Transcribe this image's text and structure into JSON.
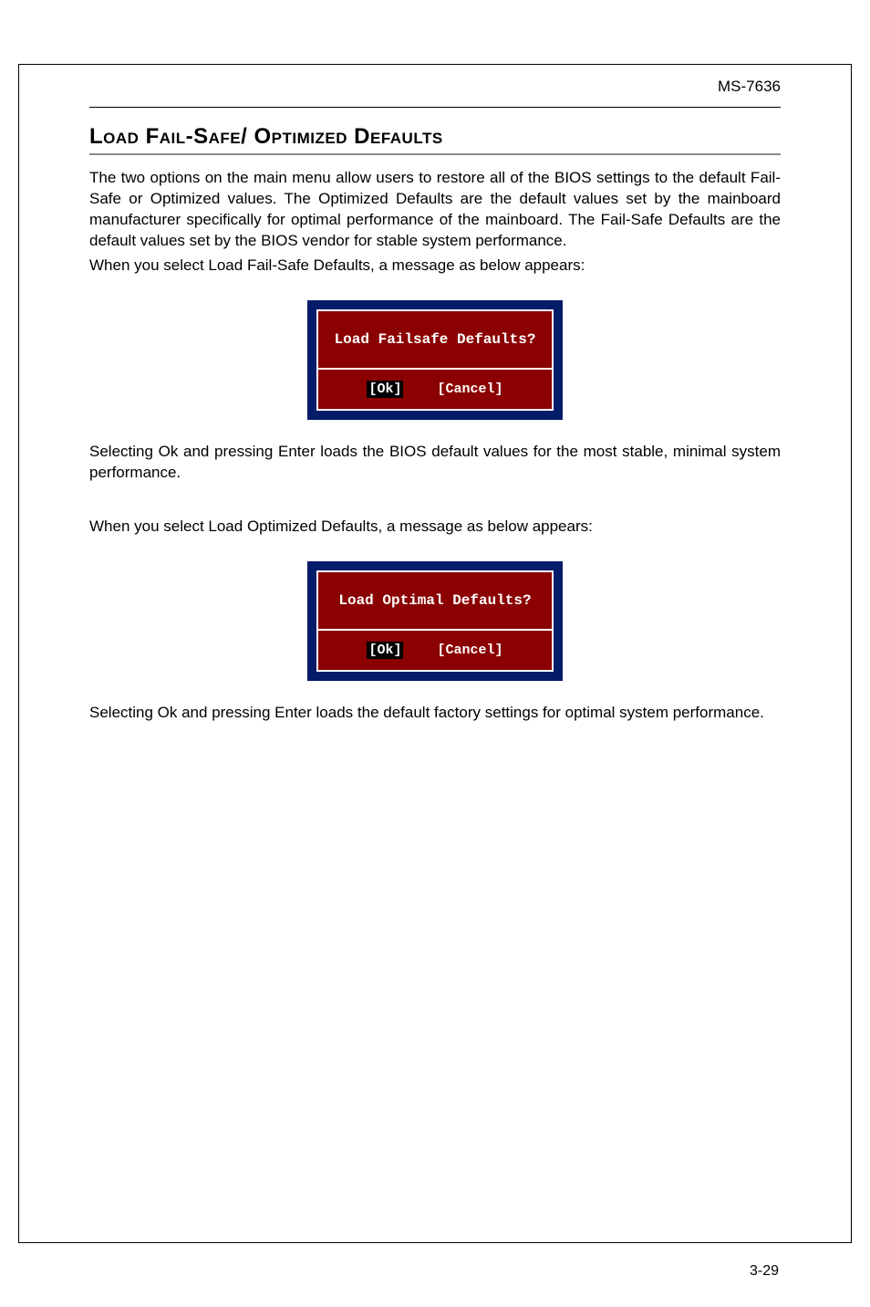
{
  "header": {
    "model": "MS-7636"
  },
  "section": {
    "title": "Load Fail-Safe/ Optimized Defaults"
  },
  "paragraphs": {
    "p1": "The two options on the main menu allow users to restore all of the BIOS settings to the default Fail-Safe or Optimized values. The Optimized Defaults are the default values set by the mainboard manufacturer specifically for optimal performance of the mainboard. The Fail-Safe Defaults are the default values set by the BIOS vendor for stable system performance.",
    "p2": "When you select Load Fail-Safe Defaults, a message as below appears:",
    "p3": "Selecting Ok and pressing Enter loads the BIOS default values for the most stable, minimal system performance.",
    "p4": "When you select Load Optimized Defaults, a message as below appears:",
    "p5": "Selecting Ok and pressing Enter loads the default factory settings for optimal system performance."
  },
  "dialog1": {
    "title": "Load Failsafe Defaults?",
    "ok": "[Ok]",
    "cancel": "[Cancel]"
  },
  "dialog2": {
    "title": "Load Optimal Defaults?",
    "ok": "[Ok]",
    "cancel": "[Cancel]"
  },
  "footer": {
    "page": "3-29"
  }
}
